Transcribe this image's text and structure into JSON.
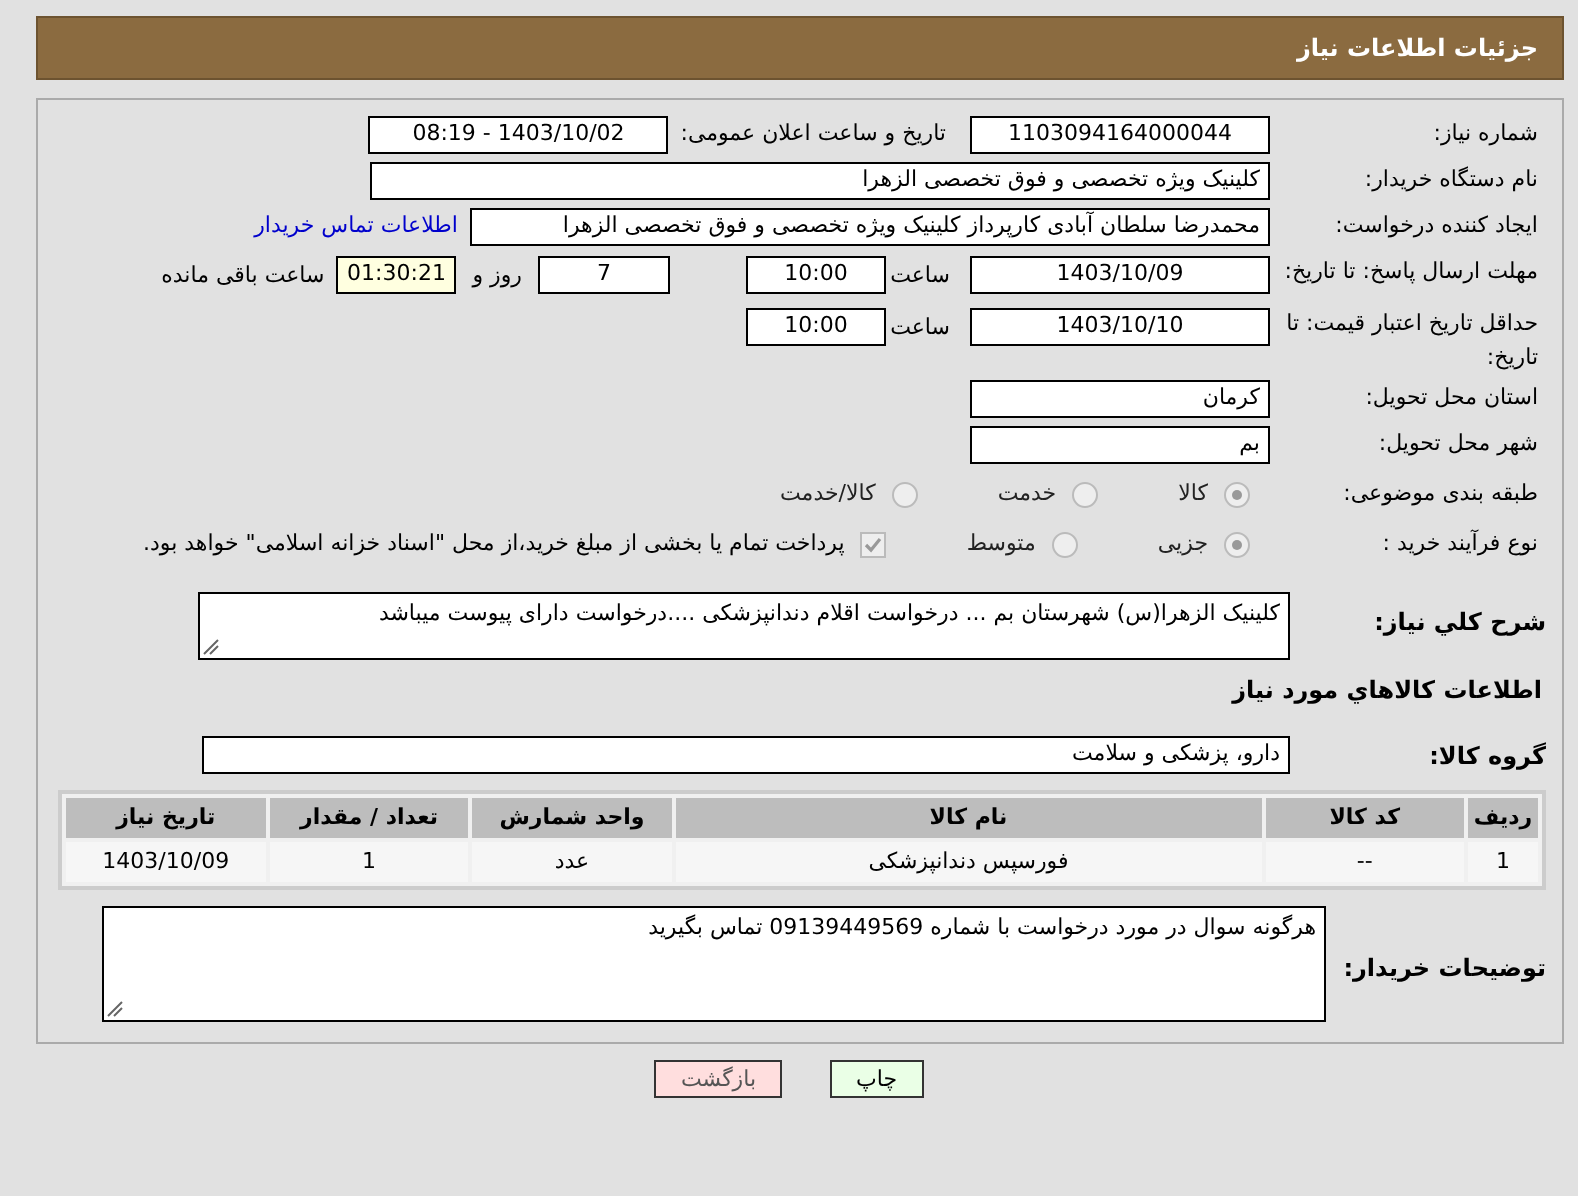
{
  "header": {
    "title": "جزئیات اطلاعات نیاز"
  },
  "need_number": {
    "label": "شماره نیاز:",
    "value": "1103094164000044"
  },
  "announce": {
    "label": "تاریخ و ساعت اعلان عمومی:",
    "value": "1403/10/02 - 08:19"
  },
  "buyer": {
    "label": "نام دستگاه خریدار:",
    "value": "کلینیک ویژه تخصصی و فوق تخصصی الزهرا"
  },
  "creator": {
    "label": "ایجاد کننده درخواست:",
    "value": "محمدرضا سلطان آبادی کارپرداز کلینیک ویژه تخصصی و فوق تخصصی الزهرا",
    "link": "اطلاعات تماس خریدار"
  },
  "deadline": {
    "label": "مهلت ارسال پاسخ: تا تاریخ:",
    "date": "1403/10/09",
    "time_label": "ساعت",
    "time": "10:00",
    "days": "7",
    "days_label": "روز و",
    "remaining": "01:30:21",
    "remaining_label": "ساعت باقی مانده"
  },
  "validity": {
    "label": "حداقل تاریخ اعتبار قیمت: تا تاریخ:",
    "date": "1403/10/10",
    "time_label": "ساعت",
    "time": "10:00"
  },
  "province": {
    "label": "استان محل تحویل:",
    "value": "کرمان"
  },
  "city": {
    "label": "شهر محل تحویل:",
    "value": "بم"
  },
  "category": {
    "label": "طبقه بندی موضوعی:",
    "options": [
      {
        "label": "کالا",
        "selected": true,
        "disabled": true
      },
      {
        "label": "خدمت",
        "selected": false,
        "disabled": true
      },
      {
        "label": "کالا/خدمت",
        "selected": false,
        "disabled": true
      }
    ]
  },
  "process": {
    "label": "نوع فرآیند خرید :",
    "options": [
      {
        "label": "جزیی",
        "selected": true,
        "disabled": true
      },
      {
        "label": "متوسط",
        "selected": false,
        "disabled": true
      }
    ],
    "payment": {
      "checked": true,
      "disabled": true,
      "text": "پرداخت تمام یا بخشی از مبلغ خرید،از محل \"اسناد خزانه اسلامی\" خواهد بود."
    }
  },
  "description": {
    "label": "شرح کلي نياز:",
    "value": "کلینیک الزهرا(س) شهرستان بم ... درخواست اقلام  دندانپزشکی ....درخواست دارای پیوست میباشد"
  },
  "goods_heading": "اطلاعات کالاهاي مورد نياز",
  "goods_group": {
    "label": "گروه کالا:",
    "value": "دارو، پزشکی و سلامت"
  },
  "table": {
    "columns": [
      "ردیف",
      "کد کالا",
      "نام کالا",
      "واحد شمارش",
      "تعداد / مقدار",
      "تاریخ نیاز"
    ],
    "rows": [
      [
        "1",
        "--",
        "فورسپس دندانپزشکی",
        "عدد",
        "1",
        "1403/10/09"
      ]
    ]
  },
  "buyer_notes": {
    "label": "توضیحات خریدار:",
    "value": "هرگونه سوال در مورد درخواست با شماره 09139449569 تماس بگیرید"
  },
  "buttons": [
    {
      "label": "چاپ",
      "kind": "print"
    },
    {
      "label": "بازگشت",
      "kind": "back"
    }
  ]
}
